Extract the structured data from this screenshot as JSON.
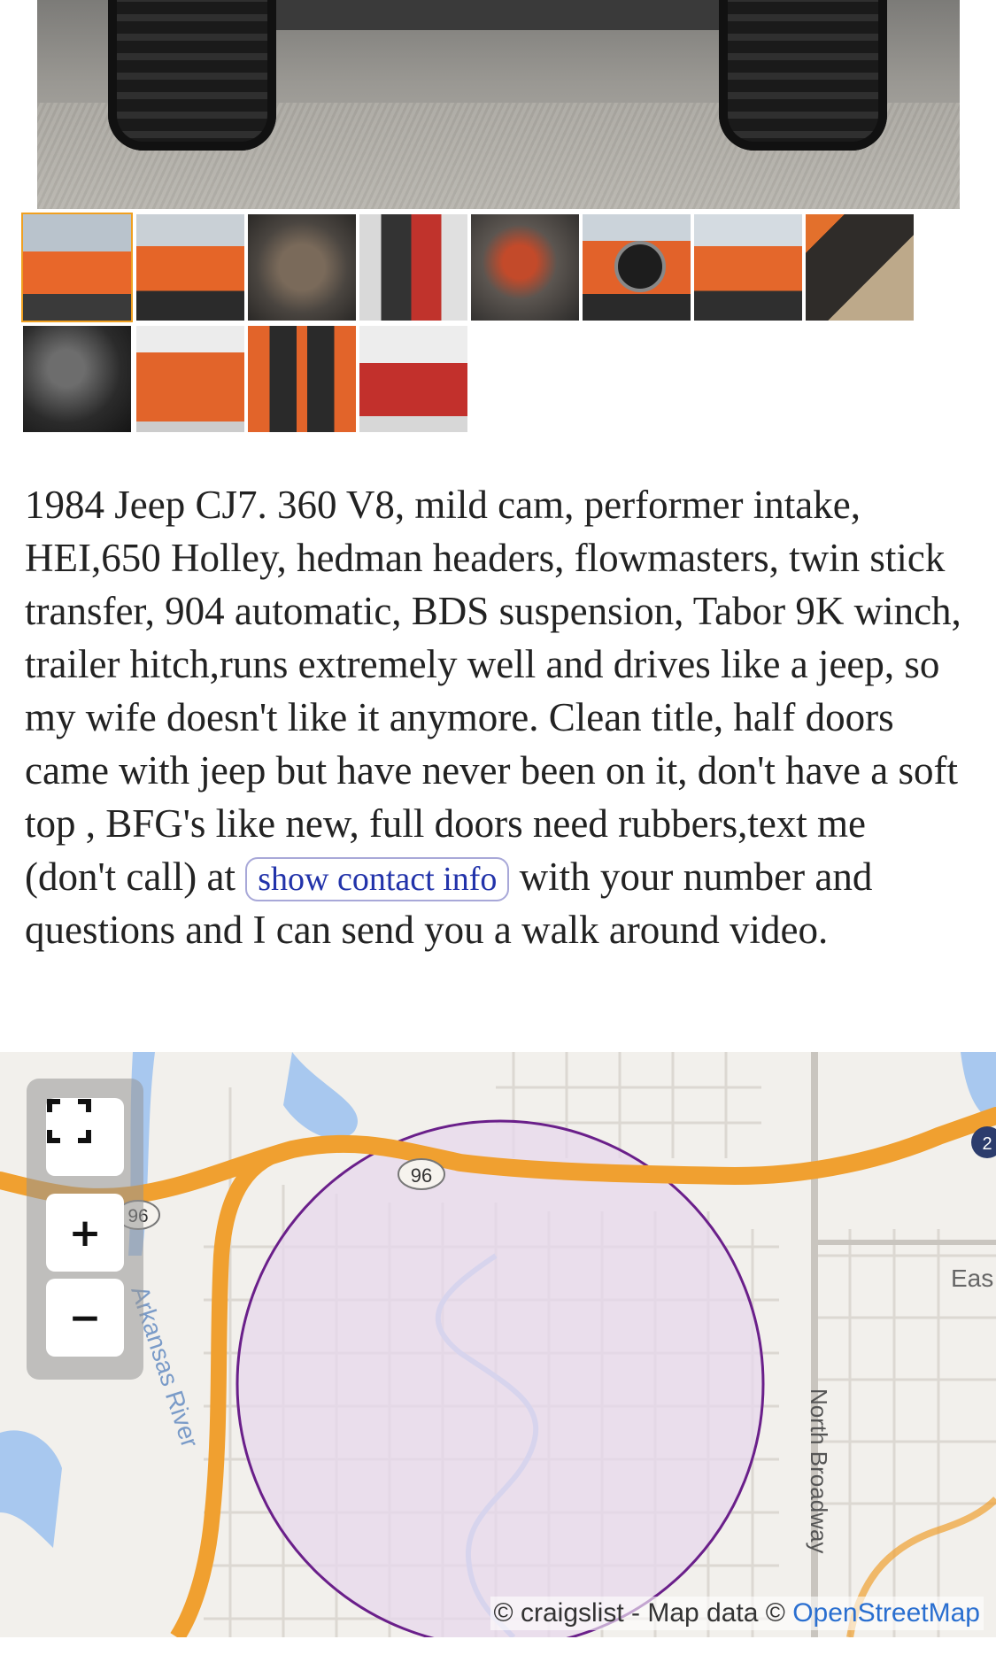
{
  "listing": {
    "description_before": "1984 Jeep CJ7. 360 V8, mild cam, performer intake, HEI,650 Holley, hedman headers, flowmasters, twin stick transfer, 904 automatic, BDS suspension, Tabor 9K winch, trailer hitch,runs extremely well and drives like a jeep, so my wife doesn't like it anymore. Clean title, half doors came with jeep but have never been on it, don't have a soft top , BFG's like new, full doors need rubbers,text me (don't call) at ",
    "contact_button": "show contact info",
    "description_after": " with your number and questions and I can send you a walk around video."
  },
  "gallery": {
    "selected_index": 0,
    "thumbnails": [
      {
        "label": "thumbnail 1"
      },
      {
        "label": "thumbnail 2"
      },
      {
        "label": "thumbnail 3"
      },
      {
        "label": "thumbnail 4"
      },
      {
        "label": "thumbnail 5"
      },
      {
        "label": "thumbnail 6"
      },
      {
        "label": "thumbnail 7"
      },
      {
        "label": "thumbnail 8"
      },
      {
        "label": "thumbnail 9"
      },
      {
        "label": "thumbnail 10"
      },
      {
        "label": "thumbnail 11"
      },
      {
        "label": "thumbnail 12"
      }
    ]
  },
  "map": {
    "controls": {
      "zoom_in": "+",
      "zoom_out": "−"
    },
    "labels": {
      "highway_96_a": "96",
      "highway_96_b": "96",
      "highway_right": "2",
      "river": "Arkansas River",
      "street": "North Broadway",
      "east": "Eas"
    },
    "attribution_prefix": "© craigslist - Map data © ",
    "attribution_link": "OpenStreetMap"
  },
  "colors": {
    "highway": "#f0a030",
    "circle_fill": "#e7d8ec",
    "circle_stroke": "#6a1f8a",
    "water": "#a8c8ef",
    "link": "#2a6fd0"
  }
}
